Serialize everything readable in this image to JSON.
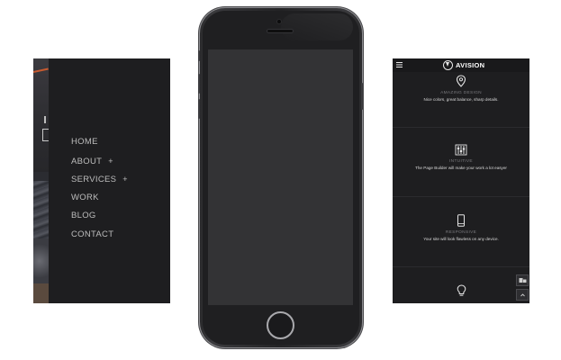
{
  "left_screen": {
    "menu": [
      {
        "label": "HOME",
        "has_submenu": false
      },
      {
        "label": "ABOUT",
        "has_submenu": true
      },
      {
        "label": "SERVICES",
        "has_submenu": true
      },
      {
        "label": "WORK",
        "has_submenu": false
      },
      {
        "label": "BLOG",
        "has_submenu": false
      },
      {
        "label": "CONTACT",
        "has_submenu": false
      }
    ],
    "submenu_indicator": "+"
  },
  "right_screen": {
    "brand": "AVISION",
    "features": [
      {
        "icon": "map-pin-icon",
        "title": "AMAZING DESIGN",
        "description": "Nice colors, great balance, sharp details."
      },
      {
        "icon": "sliders-icon",
        "title": "INTUITIVE",
        "description": "The Page Builder will make your work a lot easyer"
      },
      {
        "icon": "mobile-icon",
        "title": "RESPONSIVE",
        "description": "Your site will look flawless on any device."
      },
      {
        "icon": "lightbulb-icon",
        "title": "",
        "description": ""
      }
    ]
  },
  "colors": {
    "screen_bg": "#1e1e20",
    "menu_text": "#bdbdbd",
    "phone_screen": "#333335"
  }
}
